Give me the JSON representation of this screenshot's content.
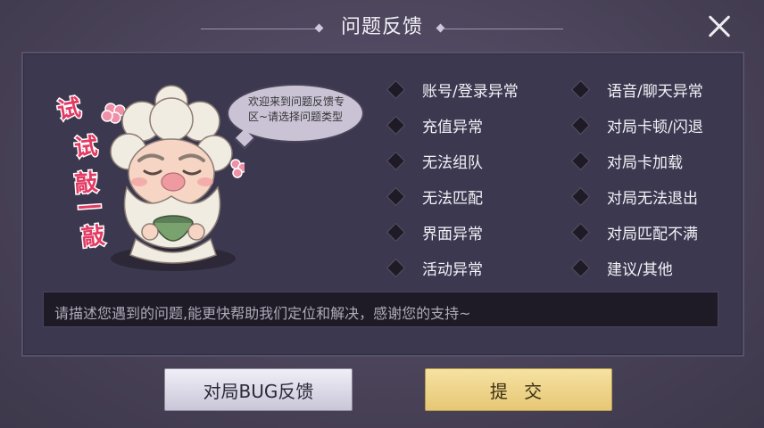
{
  "dialog": {
    "title": "问题反馈",
    "close_icon": "close-icon"
  },
  "mascot": {
    "side_text": "试试敲一敲",
    "bubble_text": "欢迎来到问题反馈专区~请选择问题类型"
  },
  "options": {
    "left": [
      {
        "label": "账号/登录异常"
      },
      {
        "label": "充值异常"
      },
      {
        "label": "无法组队"
      },
      {
        "label": "无法匹配"
      },
      {
        "label": "界面异常"
      },
      {
        "label": "活动异常"
      }
    ],
    "right": [
      {
        "label": "语音/聊天异常"
      },
      {
        "label": "对局卡顿/闪退"
      },
      {
        "label": "对局卡加载"
      },
      {
        "label": "对局无法退出"
      },
      {
        "label": "对局匹配不满"
      },
      {
        "label": "建议/其他"
      }
    ]
  },
  "description": {
    "placeholder": "请描述您遇到的问题,能更快帮助我们定位和解决，感谢您的支持~"
  },
  "buttons": {
    "bug_feedback": "对局BUG反馈",
    "submit": "提 交"
  },
  "colors": {
    "accent_gold": "#e6c774",
    "panel_bg": "#3c3850",
    "page_bg": "#4a4359"
  }
}
